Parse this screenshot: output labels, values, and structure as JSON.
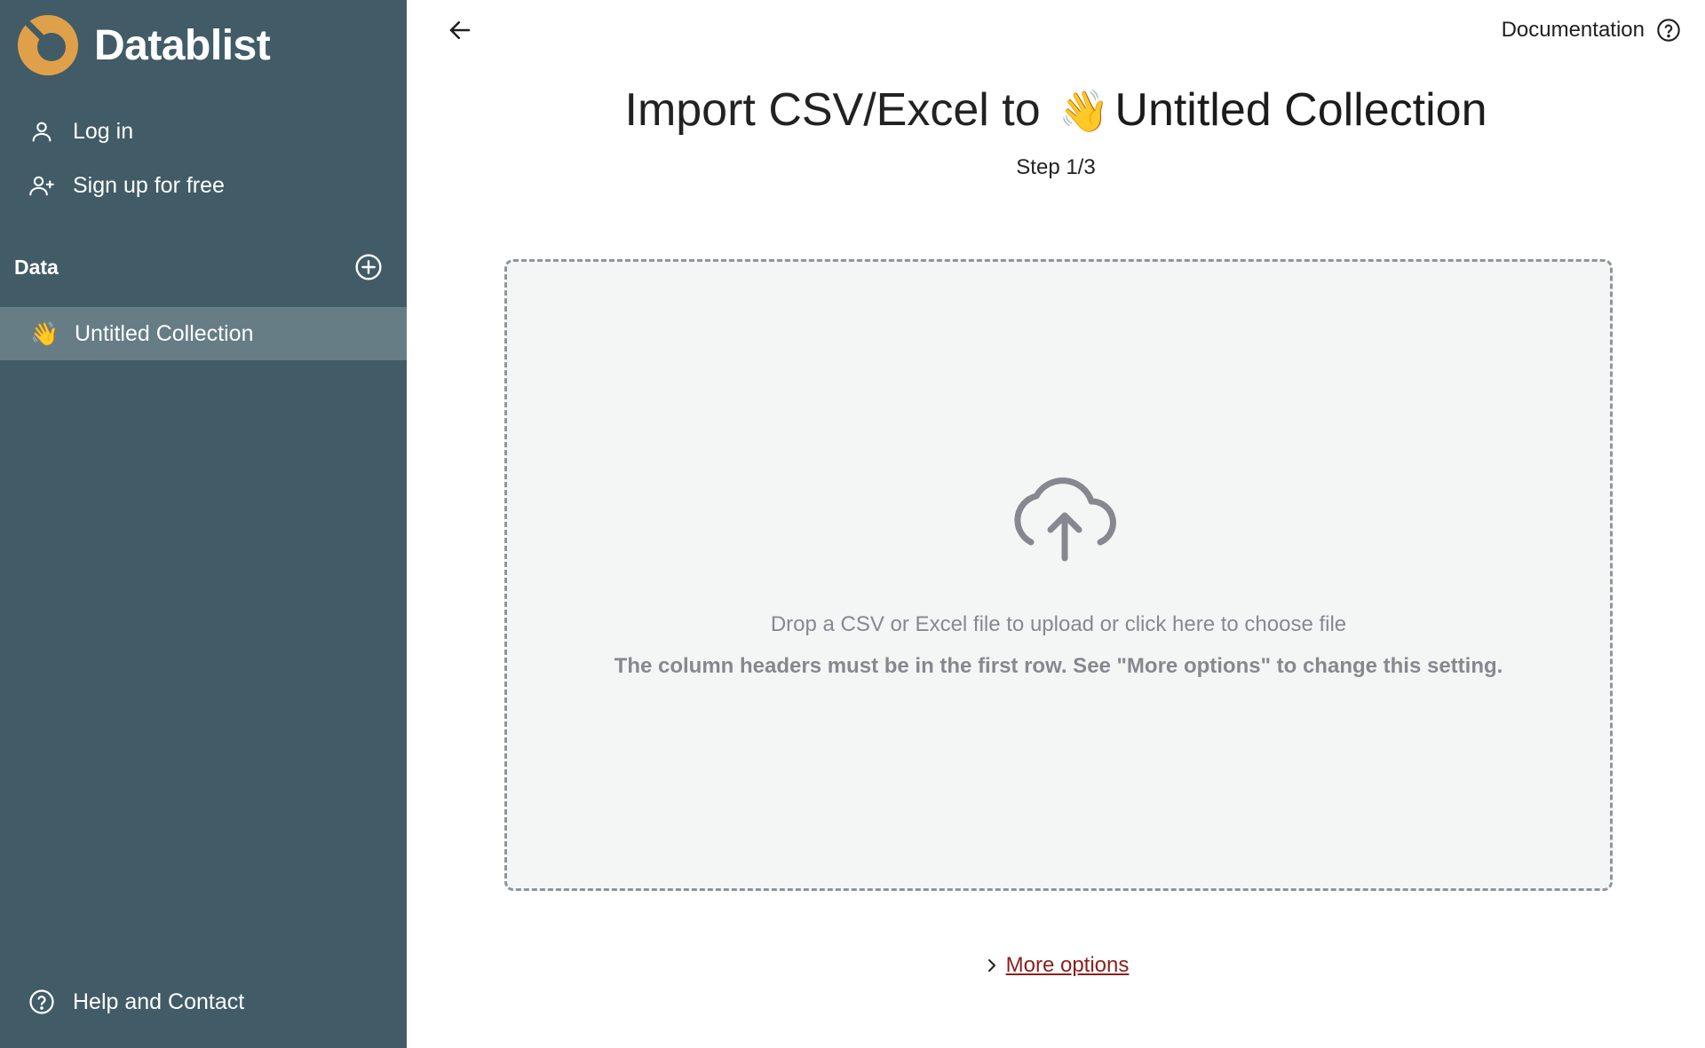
{
  "sidebar": {
    "brand": "Datablist",
    "login_label": "Log in",
    "signup_label": "Sign up for free",
    "data_section_label": "Data",
    "collections": [
      {
        "emoji": "👋",
        "label": "Untitled Collection"
      }
    ],
    "help_label": "Help and Contact"
  },
  "header": {
    "documentation_label": "Documentation"
  },
  "import": {
    "title_prefix": "Import CSV/Excel to",
    "title_emoji": "👋",
    "collection_name": "Untitled Collection",
    "step": "Step 1/3",
    "drop_text": "Drop a CSV or Excel file to upload or click here to choose file",
    "drop_note": "The column headers must be in the first row. See \"More options\" to change this setting.",
    "more_options_label": "More options"
  },
  "colors": {
    "sidebar_bg": "#415c66",
    "sidebar_active_bg": "#667d86",
    "brand_accent": "#e0a04a",
    "link": "#8b1f1f"
  }
}
